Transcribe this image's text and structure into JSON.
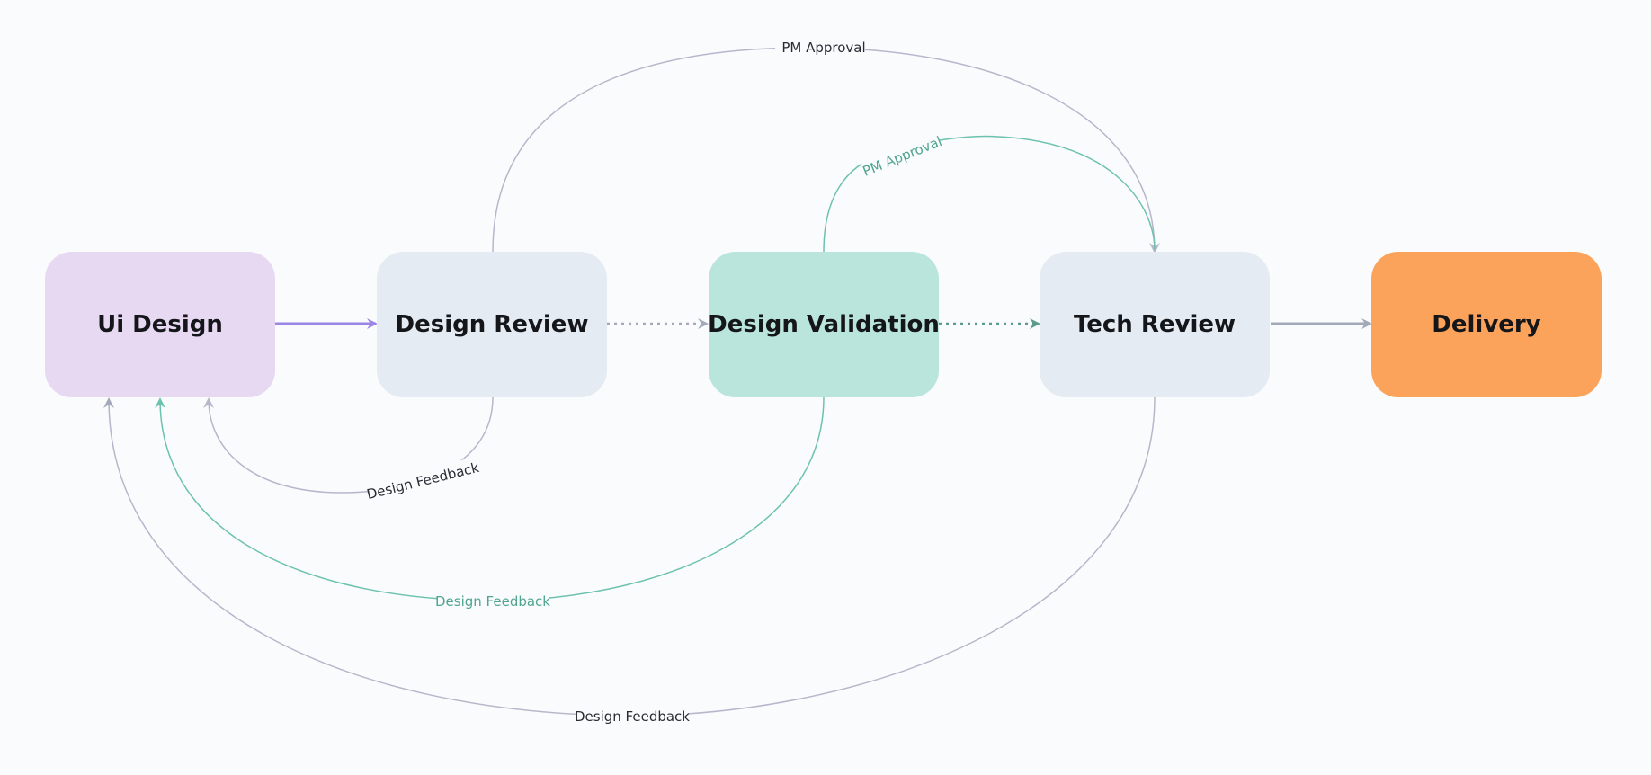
{
  "nodes": [
    {
      "id": "ui-design",
      "label": "Ui Design",
      "color": "#e7d9f2"
    },
    {
      "id": "design-review",
      "label": "Design Review",
      "color": "#e5ebf2"
    },
    {
      "id": "design-validation",
      "label": "Design Validation",
      "color": "#b9e5dc"
    },
    {
      "id": "tech-review",
      "label": "Tech Review",
      "color": "#e5ebf2"
    },
    {
      "id": "delivery",
      "label": "Delivery",
      "color": "#fba35a"
    }
  ],
  "edges": {
    "pm_approval_review_to_tech": "PM Approval",
    "pm_approval_validation_to_tech": "PM Approval",
    "feedback_review_to_ui": "Design Feedback",
    "feedback_validation_to_ui": "Design Feedback",
    "feedback_tech_to_ui": "Design Feedback"
  },
  "colors": {
    "purple": "#9b86e6",
    "gray": "#a3a9b9",
    "lavender_gray": "#b9b6cc",
    "teal": "#6cc2ae",
    "dark_teal": "#5b9c8c",
    "label_dark": "#2a2a33",
    "label_teal": "#4fa58f"
  }
}
